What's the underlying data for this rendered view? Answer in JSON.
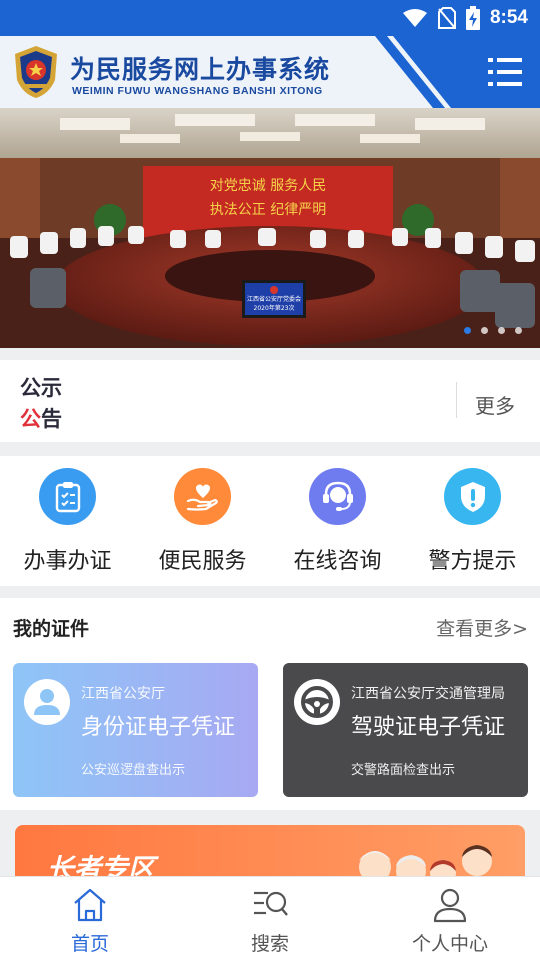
{
  "status_bar": {
    "time": "8:54"
  },
  "header": {
    "title": "为民服务网上办事系统",
    "subtitle": "WEIMIN FUWU WANGSHANG BANSHI XITONG"
  },
  "banner": {
    "wall_line1": "对党忠诚  服务人民",
    "wall_line2": "执法公正  纪律严明",
    "screen_line1": "江西省公安厅党委会",
    "screen_line2": "2020年第23次",
    "slide_count": 4,
    "active_slide": 1
  },
  "notice": {
    "label_line1": "公示",
    "label_line2_red": "公",
    "label_line2_rest": "告",
    "more": "更多"
  },
  "services": [
    {
      "label": "办事办证",
      "icon": "clipboard-icon",
      "color": "#3a9cf0"
    },
    {
      "label": "便民服务",
      "icon": "heart-hand-icon",
      "color": "#ff8a3a"
    },
    {
      "label": "在线咨询",
      "icon": "headset-icon",
      "color": "#6f7cf0"
    },
    {
      "label": "警方提示",
      "icon": "shield-alert-icon",
      "color": "#38b6f0"
    }
  ],
  "certificates": {
    "title": "我的证件",
    "more": "查看更多>",
    "cards": [
      {
        "org": "江西省公安厅",
        "name": "身份证电子凭证",
        "note": "公安巡逻盘查出示",
        "icon": "person-icon"
      },
      {
        "org": "江西省公安厅交通管理局",
        "name": "驾驶证电子凭证",
        "note": "交警路面检查出示",
        "icon": "steering-wheel-icon"
      }
    ]
  },
  "elderly": {
    "title": "长者专区"
  },
  "tabbar": [
    {
      "label": "首页",
      "icon": "home-icon",
      "active": true
    },
    {
      "label": "搜索",
      "icon": "search-icon",
      "active": false
    },
    {
      "label": "个人中心",
      "icon": "user-icon",
      "active": false
    }
  ],
  "colors": {
    "primary": "#1d64d3",
    "accent_red": "#e0303a",
    "tab_active": "#2a6ad8"
  }
}
